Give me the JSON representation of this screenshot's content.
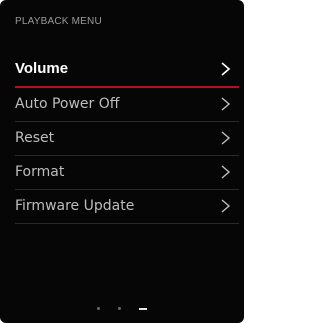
{
  "menu": {
    "title": "PLAYBACK MENU",
    "items": [
      {
        "label": "Volume",
        "selected": true
      },
      {
        "label": "Auto Power Off",
        "selected": false
      },
      {
        "label": "Reset",
        "selected": false
      },
      {
        "label": "Format",
        "selected": false
      },
      {
        "label": "Firmware Update",
        "selected": false
      }
    ],
    "chevron_icon": "chevron-right-icon",
    "highlight_color": "#b3121a"
  },
  "pager": {
    "pages": 3,
    "active_page": 3
  }
}
